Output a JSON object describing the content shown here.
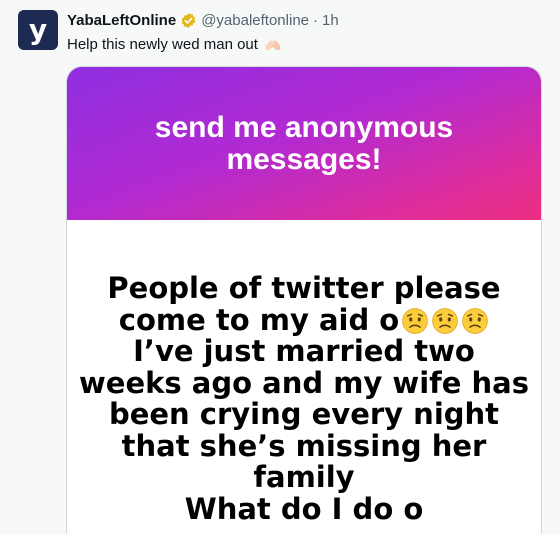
{
  "tweet": {
    "avatar_letter": "y",
    "author_name": "YabaLeftOnline",
    "handle": "@yabaleftonline",
    "separator": "·",
    "time": "1h",
    "text": "Help this newly wed man out",
    "text_emoji": "folded-hands-emoji"
  },
  "media": {
    "banner_title": "send me anonymous messages!",
    "message_lines": [
      "People of twitter please",
      "come to my aid o",
      "I’ve just married two",
      "weeks ago and my wife has",
      "been crying every night",
      "that she’s missing her",
      "family",
      "What do I do o"
    ],
    "line2_emojis": [
      "worried-face-emoji",
      "worried-face-emoji",
      "worried-face-emoji"
    ]
  },
  "colors": {
    "avatar_bg": "#1d2b53",
    "verified_gold": "#e2b719",
    "banner_gradient_start": "#8f2fe0",
    "banner_gradient_end": "#ec2e80"
  }
}
